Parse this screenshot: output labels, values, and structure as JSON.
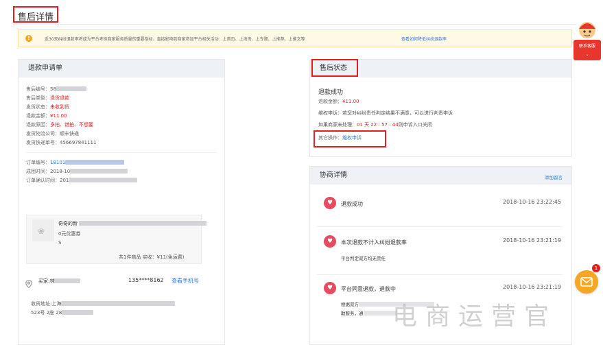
{
  "page": {
    "title": "售后详情"
  },
  "notice": {
    "text": "近30天纠纷退款率将成为平台考核商家服务质量的重要指标，直接影响到商家参加平台相关活动：上首页、上海淘、上专题、上推荐、上推文等",
    "link": "查看如何降低纠纷退款率"
  },
  "refund_form": {
    "title": "退款申请单",
    "after_sale_no_label": "售后编号：",
    "after_sale_no": "58",
    "after_sale_type_label": "售后类型：",
    "after_sale_type": "退货退款",
    "ship_status_label": "发货状态：",
    "ship_status": "未收到货",
    "refund_amount_label": "退款金额：",
    "refund_amount": "¥11.00",
    "refund_reason_label": "退款原因：",
    "refund_reason": "多拍、错拍、不想要",
    "logistics_label": "发货物流公司：",
    "logistics": "顺丰快递",
    "tracking_label": "发货快递单号：",
    "tracking": "456697841111",
    "order_no_label": "订单编号：",
    "order_no": "18101",
    "deal_time_label": "成团时间：",
    "deal_time": "2018-10",
    "confirm_time_label": "订单确认时间：",
    "confirm_time": "201",
    "product_name": "奇奇的新",
    "coupon": "0元优惠券",
    "sku": "S",
    "summary": "共1件商品  实收：¥11(免运费)",
    "buyer_label": "买家:林",
    "buyer_phone": "135****8162",
    "view_phone": "查看手机号",
    "address_label": "收货地址:上海",
    "address_line2": "523号 2座 28"
  },
  "after_sale_status": {
    "title": "售后状态",
    "status": "退款成功",
    "amount_label": "退款金额：",
    "amount": "¥11.00",
    "appeal_hint": "维权申诉：若您对纠纷责任判定结果不满意，可以进行判责申诉",
    "countdown_prefix": "如果商家未处理：",
    "countdown": "01 天 22 : 57 : 44",
    "countdown_suffix": "则申诉入口关闭",
    "other_ops_label": "其它操作：",
    "other_ops_link": "维权申诉"
  },
  "negotiation": {
    "title": "协商详情",
    "add_message": "添加留言",
    "items": [
      {
        "title": "退款成功",
        "time": "2018-10-16 23:22:45",
        "sub": ""
      },
      {
        "title": "本次退款不计入纠纷退款率",
        "time": "2018-10-16 23:21:19",
        "sub": "平台判定双方均无责任"
      },
      {
        "title": "平台同意退款，退款中",
        "time": "2018-10-16 23:21:19",
        "sub": "根据双方",
        "sub2": "助服务，通"
      }
    ]
  },
  "widget": {
    "customer_service": "联系客服",
    "chat_badge": "1"
  },
  "watermark": "电商运营官"
}
